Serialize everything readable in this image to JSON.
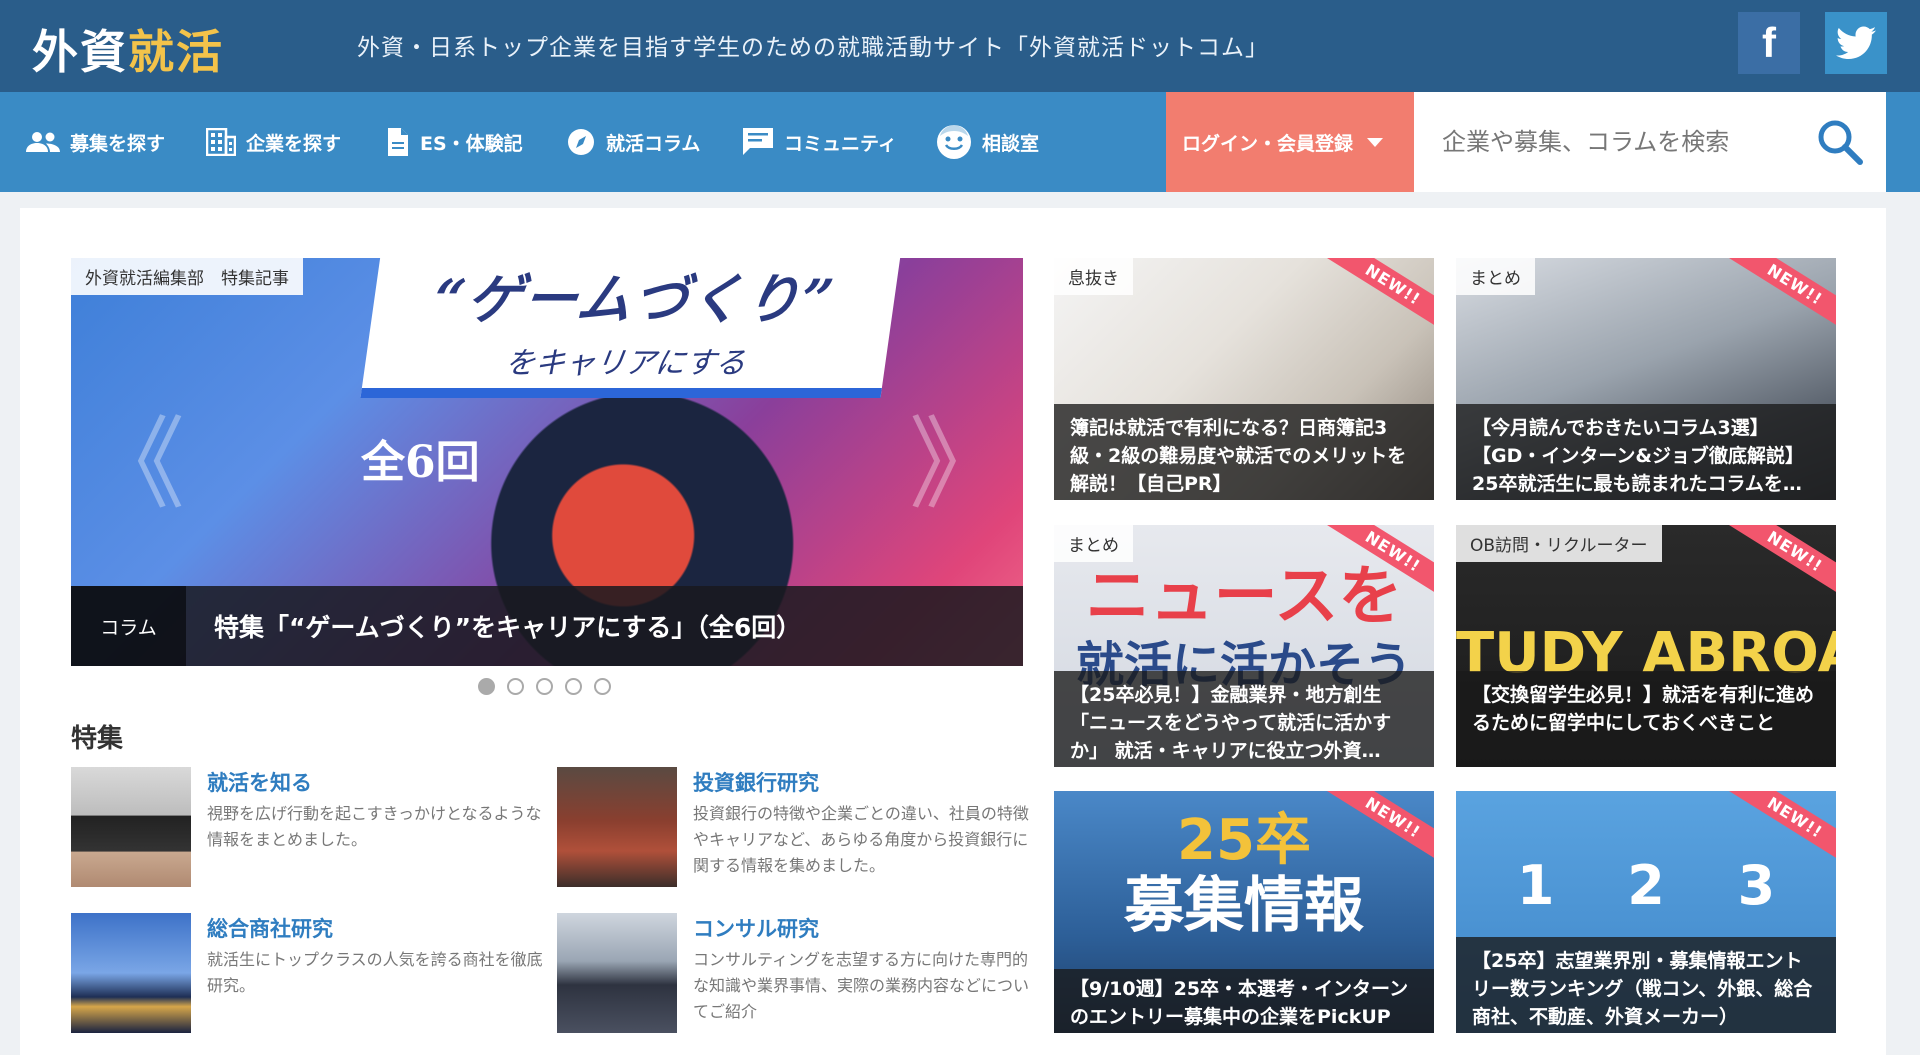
{
  "header": {
    "logo_main": "外資",
    "logo_accent": "就活",
    "tagline": "外資・日系トップ企業を目指す学生のための就職活動サイト「外資就活ドットコム」",
    "facebook_glyph": "f"
  },
  "nav": {
    "items": [
      {
        "label": "募集を探す",
        "icon": "people-icon"
      },
      {
        "label": "企業を探す",
        "icon": "building-icon"
      },
      {
        "label": "ES・体験記",
        "icon": "document-icon"
      },
      {
        "label": "就活コラム",
        "icon": "compass-icon"
      },
      {
        "label": "コミュニティ",
        "icon": "chat-icon"
      },
      {
        "label": "相談室",
        "icon": "smile-icon"
      }
    ],
    "login_label": "ログイン・会員登録",
    "search_placeholder": "企業や募集、コラムを検索"
  },
  "hero": {
    "tag": "外資就活編集部　特集記事",
    "banner_title": "“ゲームづくり”",
    "banner_sub": "をキャリアにする",
    "count_label": "全6回",
    "category": "コラム",
    "title": "特集「“ゲームづくり”をキャリアにする」（全6回）",
    "dots_total": 5,
    "dots_active": 1
  },
  "features": {
    "heading": "特集",
    "items": [
      {
        "title": "就活を知る",
        "desc": "視野を広げ行動を起こすきっかけとなるような情報をまとめました。"
      },
      {
        "title": "投資銀行研究",
        "desc": "投資銀行の特徴や企業ごとの違い、社員の特徴やキャリアなど、あらゆる角度から投資銀行に関する情報を集めました。"
      },
      {
        "title": "総合商社研究",
        "desc": "就活生にトップクラスの人気を誇る商社を徹底研究。"
      },
      {
        "title": "コンサル研究",
        "desc": "コンサルティングを志望する方に向けた専門的な知識や業界事情、実際の業務内容などについてご紹介"
      }
    ]
  },
  "cards": [
    {
      "label": "息抜き",
      "new": "NEW!!",
      "text": "簿記は就活で有利になる？日商簿記3級・2級の難易度や就活でのメリットを解説！【自己PR】"
    },
    {
      "label": "まとめ",
      "new": "NEW!!",
      "text": "【今月読んでおきたいコラム3選】【GD・インターン&ジョブ徹底解説】25卒就活生に最も読まれたコラムを…"
    },
    {
      "label": "まとめ",
      "new": "NEW!!",
      "text": "【25卒必見！】金融業界・地方創生「ニュースをどうやって就活に活かすか」 就活・キャリアに役立つ外資…",
      "bg1": "ニュースを",
      "bg2": "就活に活かそう"
    },
    {
      "label": "OB訪問・リクルーター",
      "new": "NEW!!",
      "text": "【交換留学生必見！】就活を有利に進めるために留学中にしておくべきこと",
      "bg1": "TUDY ABROAD"
    },
    {
      "label": "",
      "new": "NEW!!",
      "text": "【9/10週】25卒・本選考・インターンのエントリー募集中の企業をPickUP",
      "bg1": "25卒",
      "bg2": "募集情報"
    },
    {
      "label": "",
      "new": "NEW!!",
      "text": "【25卒】志望業界別・募集情報エントリー数ランキング（戦コン、外銀、総合商社、不動産、外資メーカー）",
      "bg1": "1 　2 　3"
    }
  ]
}
